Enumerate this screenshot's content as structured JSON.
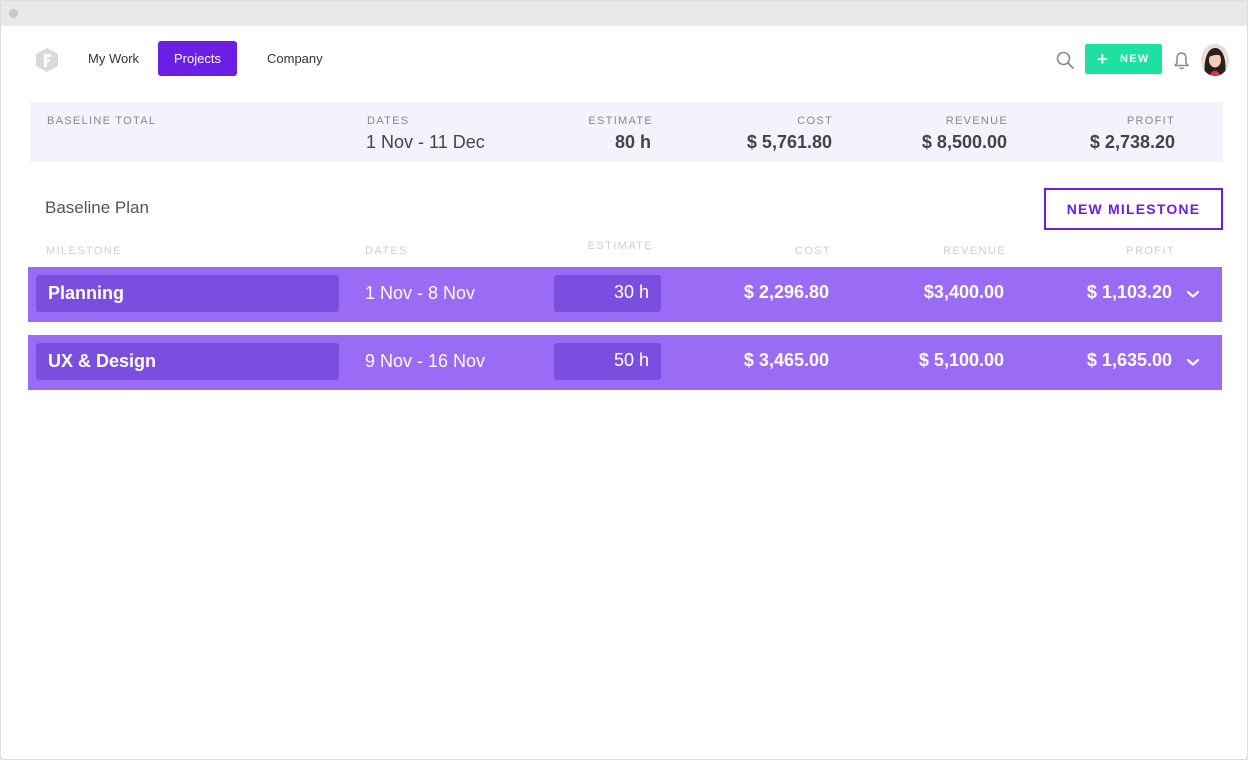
{
  "nav": {
    "items": [
      {
        "label": "My Work",
        "active": false
      },
      {
        "label": "Projects",
        "active": true
      },
      {
        "label": "Company",
        "active": false
      }
    ],
    "new_button": "NEW",
    "accent": "#6a1ee6",
    "new_color": "#1ee0a0"
  },
  "totals": {
    "label": "BASELINE TOTAL",
    "dates_label": "DATES",
    "dates": "1 Nov - 11 Dec",
    "estimate_label": "ESTIMATE",
    "estimate": "80 h",
    "cost_label": "COST",
    "cost": "$ 5,761.80",
    "revenue_label": "REVENUE",
    "revenue": "$ 8,500.00",
    "profit_label": "PROFIT",
    "profit": "$ 2,738.20"
  },
  "plan": {
    "title": "Baseline Plan",
    "new_milestone": "NEW MILESTONE",
    "headers": {
      "milestone": "MILESTONE",
      "dates": "DATES",
      "estimate": "ESTIMATE",
      "cost": "COST",
      "revenue": "REVENUE",
      "profit": "PROFIT"
    },
    "rows": [
      {
        "name": "Planning",
        "dates": "1 Nov - 8 Nov",
        "estimate": "30 h",
        "cost": "$ 2,296.80",
        "revenue": "$3,400.00",
        "profit": "$ 1,103.20"
      },
      {
        "name": "UX & Design",
        "dates": "9 Nov - 16 Nov",
        "estimate": "50 h",
        "cost": "$ 3,465.00",
        "revenue": "$ 5,100.00",
        "profit": "$ 1,635.00"
      }
    ],
    "row_color": "#9a6bf5"
  },
  "icons": [
    "logo-icon",
    "search-icon",
    "plus-icon",
    "bell-icon",
    "chevron-down-icon"
  ]
}
